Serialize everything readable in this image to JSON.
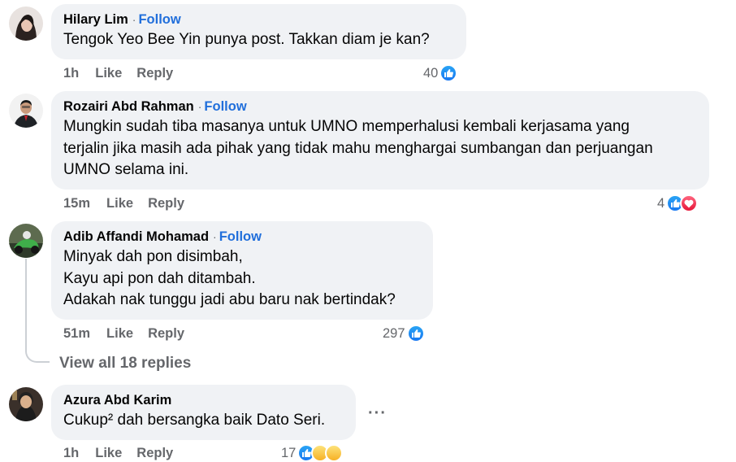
{
  "comments": [
    {
      "name": "Hilary Lim",
      "follow": "Follow",
      "lines": [
        "Tengok Yeo Bee Yin punya post. Takkan diam je kan?"
      ],
      "time": "1h",
      "like": "Like",
      "reply": "Reply",
      "reaction_count": "40",
      "reactions": [
        "like-icon"
      ]
    },
    {
      "name": "Rozairi Abd Rahman",
      "follow": "Follow",
      "lines": [
        "Mungkin sudah tiba masanya untuk UMNO memperhalusi kembali kerjasama yang",
        "terjalin jika masih ada pihak yang tidak mahu menghargai sumbangan dan perjuangan",
        "UMNO selama ini."
      ],
      "time": "15m",
      "like": "Like",
      "reply": "Reply",
      "reaction_count": "4",
      "reactions": [
        "like-icon",
        "love-icon"
      ]
    },
    {
      "name": "Adib Affandi Mohamad",
      "follow": "Follow",
      "lines": [
        "Minyak dah pon disimbah,",
        "Kayu api pon dah ditambah.",
        "Adakah nak tunggu jadi abu baru nak bertindak?"
      ],
      "time": "51m",
      "like": "Like",
      "reply": "Reply",
      "reaction_count": "297",
      "reactions": [
        "like-icon"
      ]
    },
    {
      "name": "Azura Abd Karim",
      "lines": [
        "Cukup² dah bersangka baik Dato Seri."
      ],
      "time": "1h",
      "like": "Like",
      "reply": "Reply",
      "reaction_count": "17",
      "reactions": [
        "like-icon",
        "haha-icon",
        "haha-icon"
      ]
    }
  ],
  "view_replies": "View all 18 replies",
  "more_options": "···",
  "colors": {
    "bubble": "#f0f2f5",
    "follow": "#216fdb",
    "meta": "#65676b",
    "like": "#1877f2",
    "love": "#e61739"
  }
}
